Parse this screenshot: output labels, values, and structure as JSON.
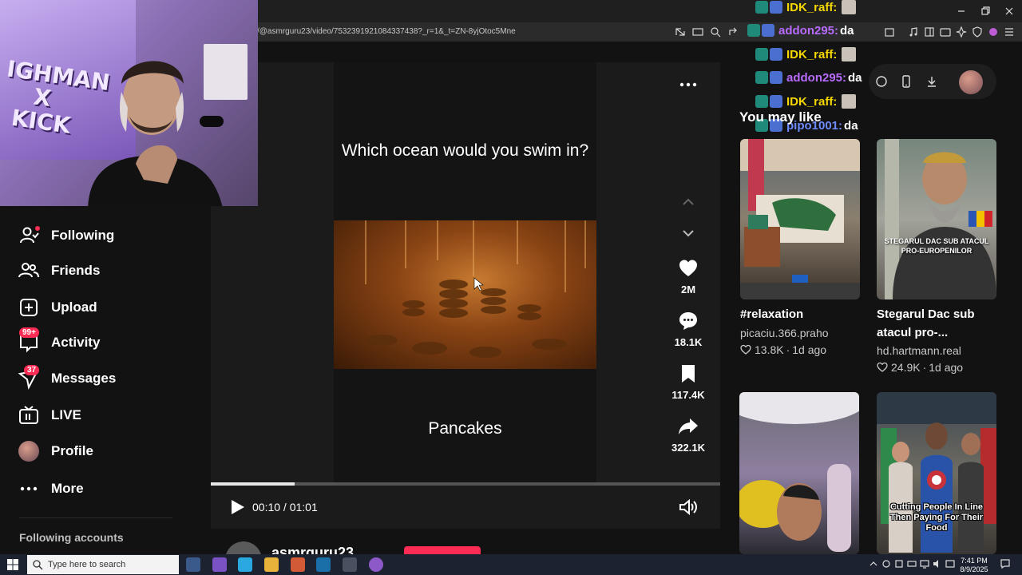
{
  "browser": {
    "url": "/@asmrguru23/video/7532391921084337438?_r=1&_t=ZN-8yjOtoc5Mne"
  },
  "sidebar": {
    "items": [
      {
        "label": "Following",
        "icon": "following-icon"
      },
      {
        "label": "Friends",
        "icon": "friends-icon"
      },
      {
        "label": "Upload",
        "icon": "upload-icon"
      },
      {
        "label": "Activity",
        "icon": "activity-icon",
        "badge": "99+"
      },
      {
        "label": "Messages",
        "icon": "messages-icon",
        "badge": "37"
      },
      {
        "label": "LIVE",
        "icon": "live-icon"
      },
      {
        "label": "Profile",
        "icon": "profile-avatar"
      },
      {
        "label": "More",
        "icon": "more-dots-icon"
      }
    ],
    "following_accounts": "Following accounts"
  },
  "webcam": {
    "poster_text": "IGHMAN\nX\nKICK"
  },
  "video": {
    "question": "Which ocean would you swim in?",
    "answer": "Pancakes",
    "time": "00:10 / 01:01",
    "progress": 0.164,
    "actions": {
      "likes": "2M",
      "comments": "18.1K",
      "saves": "117.4K",
      "shares": "322.1K"
    },
    "author": "asmrguru23"
  },
  "chat": [
    {
      "name": "IDK_raff:",
      "color": "#f5d800",
      "msg": ""
    },
    {
      "name": "addon295:",
      "color": "#b86bff",
      "msg": "da"
    },
    {
      "name": "IDK_raff:",
      "color": "#f5d800",
      "msg": ""
    },
    {
      "name": "addon295:",
      "color": "#b86bff",
      "msg": "da"
    },
    {
      "name": "IDK_raff:",
      "color": "#f5d800",
      "msg": ""
    },
    {
      "name": "pipo1001:",
      "color": "#6f8cff",
      "msg": "da"
    }
  ],
  "recommendations": {
    "title": "You may like",
    "cards": [
      {
        "title": "#relaxation",
        "author": "picaciu.366.praho",
        "likes": "13.8K",
        "age": "1d ago"
      },
      {
        "title": "Stegarul Dac sub atacul pro-...",
        "author": "hd.hartmann.real",
        "likes": "24.9K",
        "age": "1d ago",
        "overlay": "STEGARUL DAC SUB ATACUL PRO-EUROPENILOR"
      },
      {
        "title": "",
        "author": "",
        "likes": "",
        "age": ""
      },
      {
        "title": "",
        "author": "",
        "likes": "",
        "age": "",
        "overlay": "Cutting People In Line Then Paying For Their Food"
      }
    ]
  },
  "taskbar": {
    "search_placeholder": "Type here to search",
    "time": "7:41 PM",
    "date": "8/9/2025"
  },
  "colors": {
    "accent": "#fe2c55",
    "background": "#121212"
  }
}
